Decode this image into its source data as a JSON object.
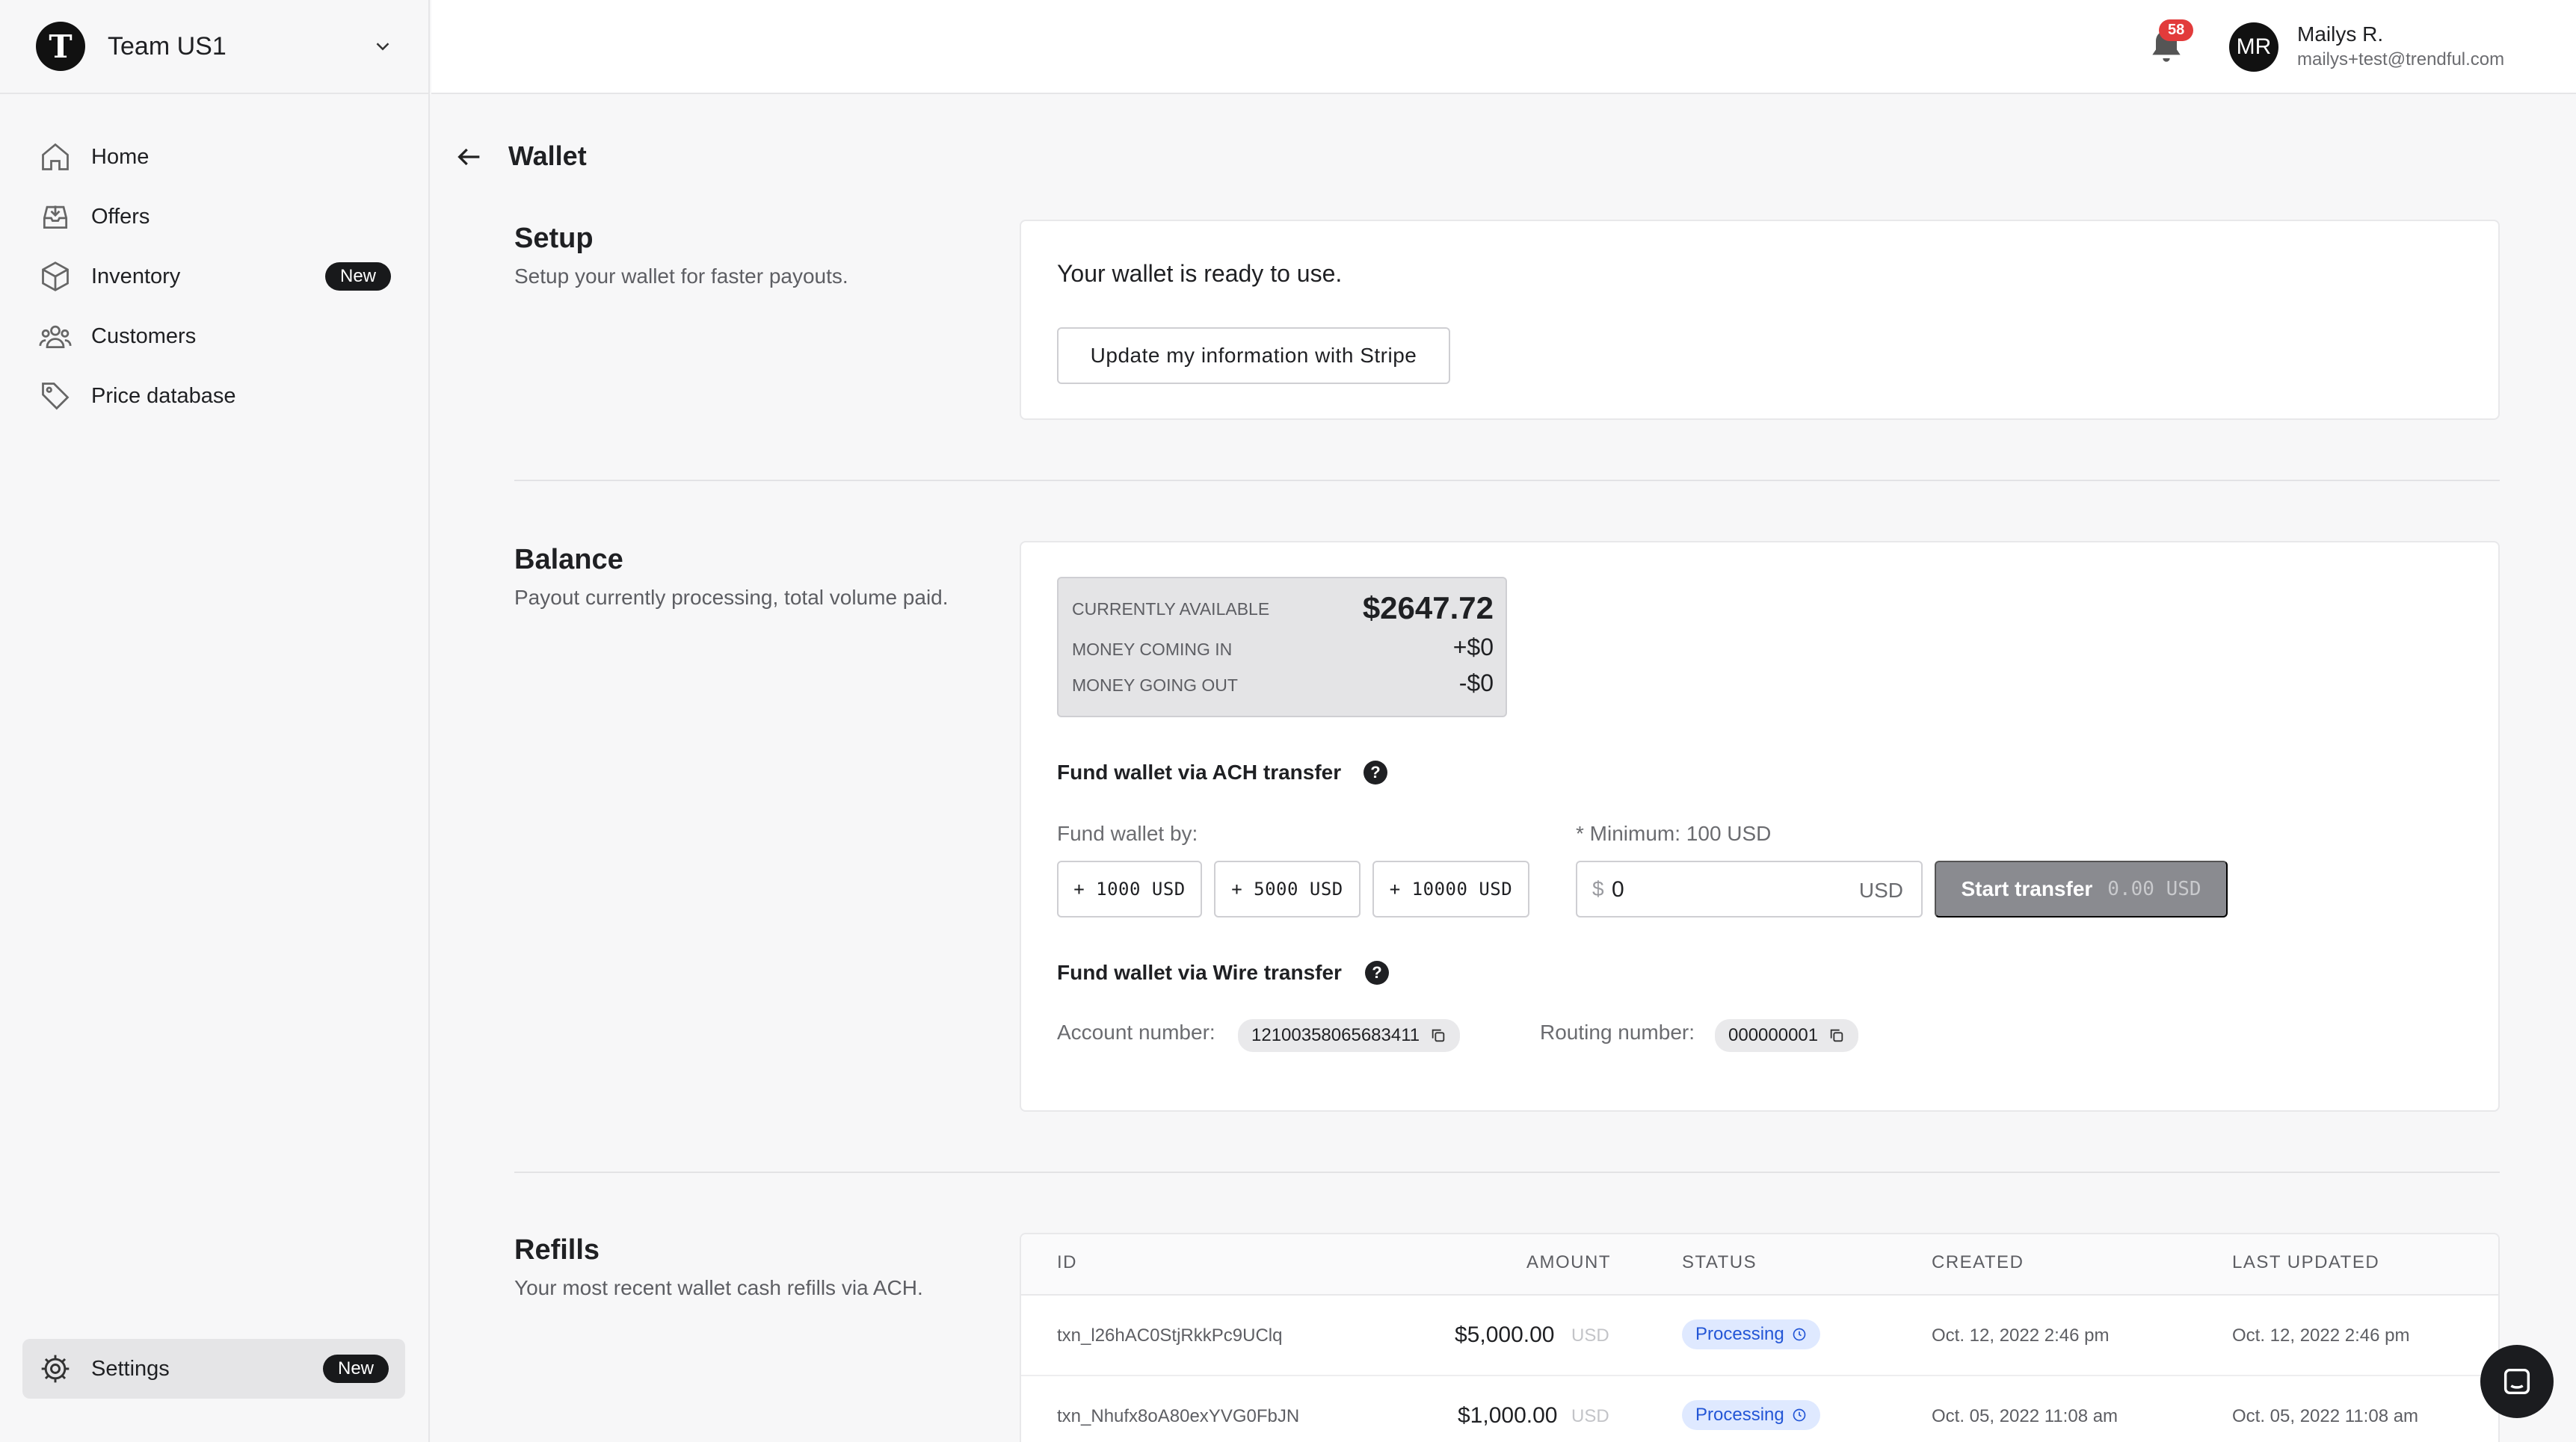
{
  "team": {
    "logo_letter": "T",
    "name": "Team US1"
  },
  "nav": {
    "home": "Home",
    "offers": "Offers",
    "inventory": "Inventory",
    "inventory_badge": "New",
    "customers": "Customers",
    "price_database": "Price database",
    "settings": "Settings",
    "settings_badge": "New"
  },
  "topbar": {
    "notification_count": "58",
    "avatar_initials": "MR",
    "user_name": "Mailys R.",
    "user_email": "mailys+test@trendful.com"
  },
  "page": {
    "title": "Wallet"
  },
  "setup": {
    "title": "Setup",
    "description": "Setup your wallet for faster payouts.",
    "ready_text": "Your wallet is ready to use.",
    "stripe_button": "Update my information with Stripe"
  },
  "balance": {
    "title": "Balance",
    "description": "Payout currently processing, total volume paid.",
    "available_label": "CURRENTLY AVAILABLE",
    "available_value": "$2647.72",
    "coming_in_label": "MONEY COMING IN",
    "coming_in_value": "+$0",
    "going_out_label": "MONEY GOING OUT",
    "going_out_value": "-$0",
    "ach_heading": "Fund wallet via ACH transfer",
    "fund_by_label": "Fund wallet by:",
    "quick_amounts": [
      "+ 1000 USD",
      "+ 5000 USD",
      "+ 10000 USD"
    ],
    "minimum_label": "* Minimum: 100 USD",
    "currency_symbol": "$",
    "amount_value": "0",
    "currency_suffix": "USD",
    "transfer_button": "Start transfer",
    "transfer_amount": "0.00 USD",
    "wire_heading": "Fund wallet via Wire transfer",
    "account_label": "Account number:",
    "account_number": "12100358065683411",
    "routing_label": "Routing number:",
    "routing_number": "000000001"
  },
  "refills": {
    "title": "Refills",
    "description": "Your most recent wallet cash refills via ACH.",
    "columns": {
      "id": "ID",
      "amount": "AMOUNT",
      "status": "STATUS",
      "created": "CREATED",
      "last_updated": "LAST UPDATED"
    },
    "rows": [
      {
        "id": "txn_l26hAC0StjRkkPc9UClq",
        "amount": "$5,000.00",
        "currency": "USD",
        "status": "Processing",
        "created": "Oct. 12, 2022 2:46 pm",
        "updated": "Oct. 12, 2022 2:46 pm"
      },
      {
        "id": "txn_Nhufx8oA80exYVG0FbJN",
        "amount": "$1,000.00",
        "currency": "USD",
        "status": "Processing",
        "created": "Oct. 05, 2022 11:08 am",
        "updated": "Oct. 05, 2022 11:08 am"
      }
    ]
  },
  "icons": {
    "home": "home-icon",
    "offers": "inbox-icon",
    "inventory": "box-icon",
    "customers": "users-icon",
    "price_database": "tag-icon",
    "settings": "gear-icon",
    "bell": "bell-icon",
    "back": "arrow-left-icon",
    "copy": "copy-icon",
    "clock": "clock-icon",
    "chat": "chat-icon",
    "help": "help-icon"
  }
}
